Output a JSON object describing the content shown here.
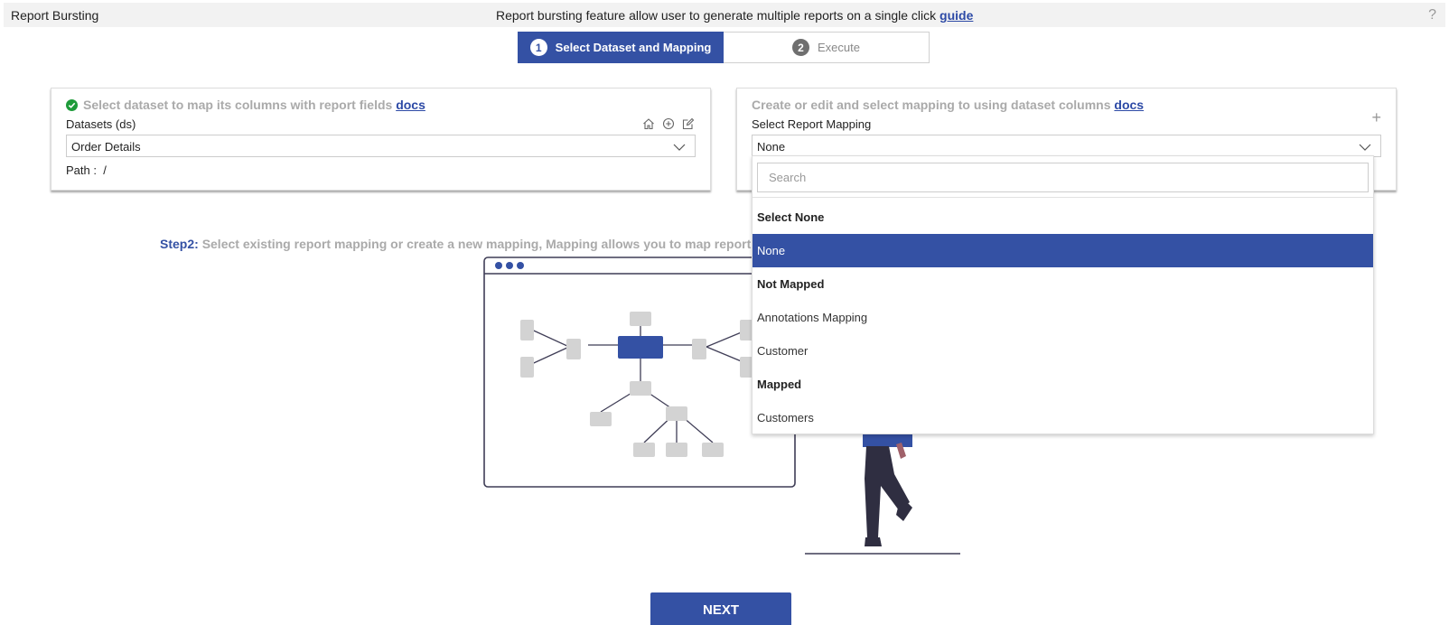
{
  "header": {
    "title": "Report Bursting",
    "message": "Report bursting feature allow user to generate multiple reports on a single click",
    "guide_link": "guide",
    "help": "?"
  },
  "steps": [
    {
      "number": "1",
      "label": "Select Dataset and Mapping",
      "active": true
    },
    {
      "number": "2",
      "label": "Execute",
      "active": false
    }
  ],
  "dataset_card": {
    "title": "Select dataset to map its columns with report fields",
    "docs_link": "docs",
    "label": "Datasets (ds)",
    "selected": "Order Details",
    "path_label": "Path :",
    "path_value": "/"
  },
  "mapping_card": {
    "title": "Create or edit and select mapping to using dataset columns",
    "docs_link": "docs",
    "label": "Select Report Mapping",
    "selected": "None",
    "add": "+"
  },
  "dropdown": {
    "search_placeholder": "Search",
    "items": [
      {
        "text": "Select None",
        "type": "group"
      },
      {
        "text": "None",
        "type": "option",
        "selected": true
      },
      {
        "text": "Not Mapped",
        "type": "group"
      },
      {
        "text": "Annotations Mapping",
        "type": "option"
      },
      {
        "text": "Customer",
        "type": "option"
      },
      {
        "text": "Mapped",
        "type": "group"
      },
      {
        "text": "Customers",
        "type": "option"
      }
    ]
  },
  "step2": {
    "label": "Step2:",
    "text": "Select existing report mapping or create a new mapping, Mapping allows you to map report par"
  },
  "next_button": "NEXT",
  "colors": {
    "primary": "#3451a4",
    "success": "#1e9b3a",
    "muted": "#aaaaaa"
  }
}
